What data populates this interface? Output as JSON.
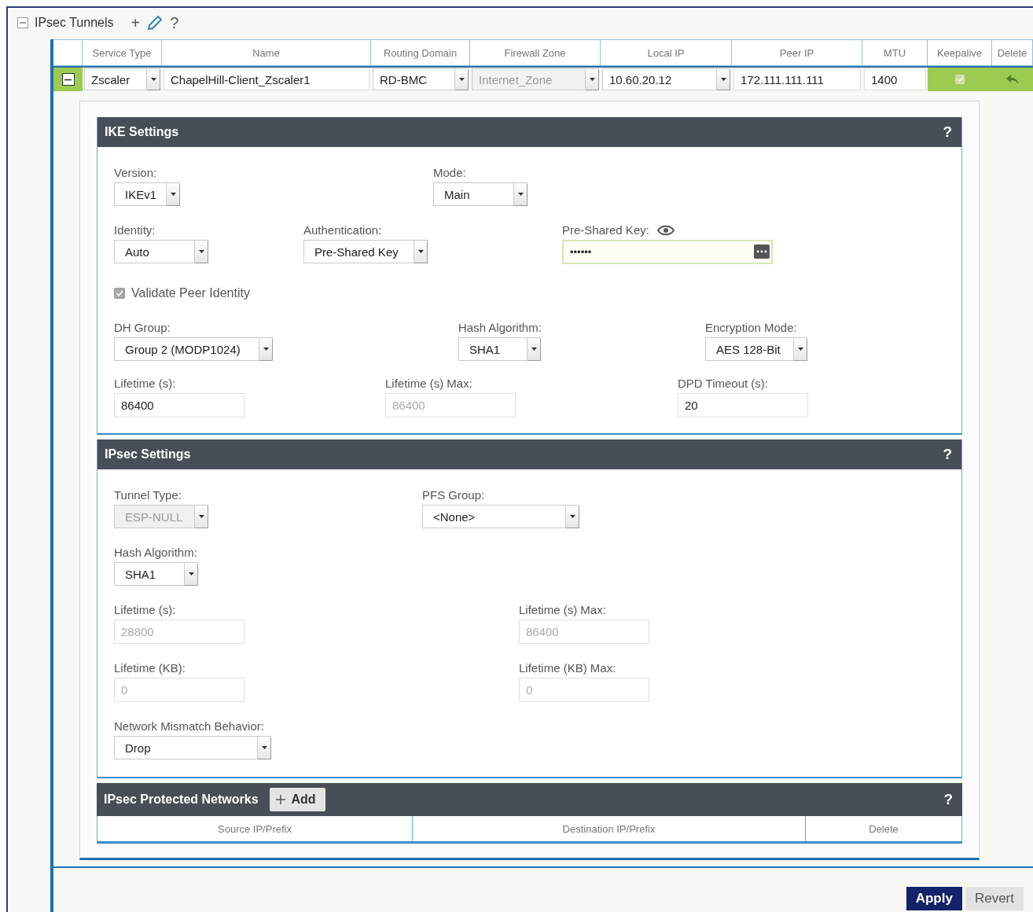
{
  "tree": {
    "title": "IPsec Tunnels",
    "expanded": true,
    "tools": [
      {
        "kind": "text",
        "label": "+"
      },
      {
        "kind": "edit"
      },
      {
        "kind": "text",
        "label": "?"
      }
    ]
  },
  "tunnels": {
    "columns": [
      "Service Type",
      "Name",
      "Routing Domain",
      "Firewall Zone",
      "Local IP",
      "Peer IP",
      "MTU",
      "Keepalive",
      "Delete"
    ],
    "rows": [
      {
        "expanded": true,
        "cells": [
          {
            "kind": "select",
            "value": "Zscaler",
            "disabled": false
          },
          {
            "kind": "text",
            "value": "ChapelHill-Client_Zscaler1",
            "disabled": false
          },
          {
            "kind": "select",
            "value": "RD-BMC",
            "disabled": false
          },
          {
            "kind": "select",
            "value": "Internet_Zone",
            "disabled": true
          },
          {
            "kind": "select",
            "value": "10.60.20.12",
            "disabled": false
          },
          {
            "kind": "text",
            "value": "172.111.111.111",
            "disabled": false
          },
          {
            "kind": "text",
            "value": "1400",
            "disabled": false
          },
          {
            "kind": "check",
            "checked": true
          },
          {
            "kind": "revert"
          }
        ]
      }
    ]
  },
  "sections": [
    {
      "title": "IKE Settings",
      "help": "?",
      "rows": [
        [
          {
            "kind": "select",
            "label": "Version:",
            "value": "IKEv1",
            "disabled": false
          },
          {
            "kind": "select",
            "label": "Mode:",
            "value": "Main",
            "disabled": false
          }
        ],
        [
          {
            "kind": "select",
            "label": "Identity:",
            "value": "Auto",
            "disabled": false
          },
          {
            "kind": "select",
            "label": "Authentication:",
            "value": "Pre-Shared Key",
            "disabled": false
          },
          {
            "kind": "secret",
            "label": "Pre-Shared Key:",
            "value": "••••••",
            "disabled": false
          }
        ],
        [
          {
            "kind": "checkbox",
            "label": "Validate Peer Identity",
            "checked": true,
            "disabled": true
          }
        ],
        [
          {
            "kind": "select",
            "label": "DH Group:",
            "value": "Group 2 (MODP1024)",
            "disabled": false
          },
          {
            "kind": "select",
            "label": "Hash Algorithm:",
            "value": "SHA1",
            "disabled": false
          },
          {
            "kind": "select",
            "label": "Encryption Mode:",
            "value": "AES 128-Bit",
            "disabled": false
          }
        ],
        [
          {
            "kind": "text",
            "label": "Lifetime (s):",
            "value": "86400",
            "disabled": false
          },
          {
            "kind": "text",
            "label": "Lifetime (s) Max:",
            "value": "86400",
            "disabled": true
          },
          {
            "kind": "text",
            "label": "DPD Timeout (s):",
            "value": "20",
            "disabled": false
          }
        ]
      ]
    },
    {
      "title": "IPsec Settings",
      "help": "?",
      "rows": [
        [
          {
            "kind": "select",
            "label": "Tunnel Type:",
            "value": "ESP-NULL",
            "disabled": true
          },
          {
            "kind": "select",
            "label": "PFS Group:",
            "value": "<None>",
            "disabled": false
          }
        ],
        [
          {
            "kind": "select",
            "label": "Hash Algorithm:",
            "value": "SHA1",
            "disabled": false
          }
        ],
        [
          {
            "kind": "text",
            "label": "Lifetime (s):",
            "value": "28800",
            "disabled": true
          },
          {
            "kind": "text",
            "label": "Lifetime (s) Max:",
            "value": "86400",
            "disabled": true
          }
        ],
        [
          {
            "kind": "text",
            "label": "Lifetime (KB):",
            "value": "0",
            "disabled": true
          },
          {
            "kind": "text",
            "label": "Lifetime (KB) Max:",
            "value": "0",
            "disabled": true
          }
        ],
        [
          {
            "kind": "select",
            "label": "Network Mismatch Behavior:",
            "value": "Drop",
            "disabled": false
          }
        ]
      ]
    }
  ],
  "protected_networks": {
    "title": "IPsec Protected Networks",
    "add_button": "Add",
    "help": "?",
    "columns": [
      "Source IP/Prefix",
      "Destination IP/Prefix",
      "Delete"
    ]
  },
  "buttons": [
    {
      "label": "Apply",
      "primary": true
    },
    {
      "label": "Revert",
      "primary": false
    }
  ]
}
